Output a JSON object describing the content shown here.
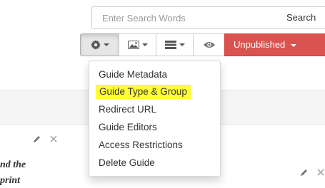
{
  "search": {
    "placeholder": "Enter Search Words",
    "button_label": "Search"
  },
  "toolbar": {
    "gear_icon": "gear-icon",
    "image_icon": "image-icon",
    "layout_icon": "layout-icon",
    "eye_icon": "eye-icon",
    "status_label": "Unpublished",
    "status_color": "#d9534f"
  },
  "dropdown": {
    "items": [
      {
        "label": "Guide Metadata",
        "highlighted": false
      },
      {
        "label": "Guide Type & Group",
        "highlighted": true
      },
      {
        "label": "Redirect URL",
        "highlighted": false
      },
      {
        "label": "Guide Editors",
        "highlighted": false
      },
      {
        "label": "Access Restrictions",
        "highlighted": false
      },
      {
        "label": "Delete Guide",
        "highlighted": false
      }
    ],
    "highlight_color": "#ffff33"
  },
  "background": {
    "text_line1": "nd the",
    "text_line2": "print",
    "edit_icon": "pencil-icon",
    "remove_icon": "close-icon"
  }
}
